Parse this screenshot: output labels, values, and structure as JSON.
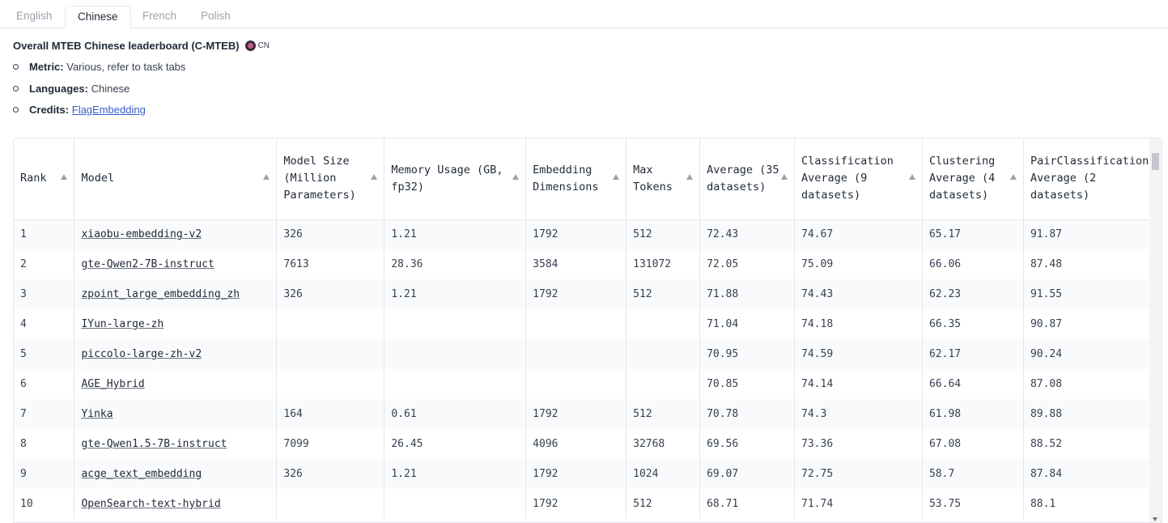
{
  "tabs": [
    "English",
    "Chinese",
    "French",
    "Polish"
  ],
  "active_tab": "Chinese",
  "description": {
    "title": "Overall MTEB Chinese leaderboard (C-MTEB)",
    "flag_code": "CN",
    "metric_label": "Metric:",
    "metric_value": "Various, refer to task tabs",
    "languages_label": "Languages:",
    "languages_value": "Chinese",
    "credits_label": "Credits:",
    "credits_link": "FlagEmbedding"
  },
  "table": {
    "headers": [
      "Rank",
      "Model",
      "Model Size (Million Parameters)",
      "Memory Usage (GB, fp32)",
      "Embedding Dimensions",
      "Max Tokens",
      "Average (35 datasets)",
      "Classification Average (9 datasets)",
      "Clustering Average (4 datasets)",
      "PairClassification Average (2 datasets)"
    ],
    "rows": [
      [
        "1",
        "xiaobu-embedding-v2",
        "326",
        "1.21",
        "1792",
        "512",
        "72.43",
        "74.67",
        "65.17",
        "91.87"
      ],
      [
        "2",
        "gte-Qwen2-7B-instruct",
        "7613",
        "28.36",
        "3584",
        "131072",
        "72.05",
        "75.09",
        "66.06",
        "87.48"
      ],
      [
        "3",
        "zpoint_large_embedding_zh",
        "326",
        "1.21",
        "1792",
        "512",
        "71.88",
        "74.43",
        "62.23",
        "91.55"
      ],
      [
        "4",
        "IYun-large-zh",
        "",
        "",
        "",
        "",
        "71.04",
        "74.18",
        "66.35",
        "90.87"
      ],
      [
        "5",
        "piccolo-large-zh-v2",
        "",
        "",
        "",
        "",
        "70.95",
        "74.59",
        "62.17",
        "90.24"
      ],
      [
        "6",
        "AGE_Hybrid",
        "",
        "",
        "",
        "",
        "70.85",
        "74.14",
        "66.64",
        "87.08"
      ],
      [
        "7",
        "Yinka",
        "164",
        "0.61",
        "1792",
        "512",
        "70.78",
        "74.3",
        "61.98",
        "89.88"
      ],
      [
        "8",
        "gte-Qwen1.5-7B-instruct",
        "7099",
        "26.45",
        "4096",
        "32768",
        "69.56",
        "73.36",
        "67.08",
        "88.52"
      ],
      [
        "9",
        "acge_text_embedding",
        "326",
        "1.21",
        "1792",
        "1024",
        "69.07",
        "72.75",
        "58.7",
        "87.84"
      ],
      [
        "10",
        "OpenSearch-text-hybrid",
        "",
        "",
        "1792",
        "512",
        "68.71",
        "71.74",
        "53.75",
        "88.1"
      ]
    ]
  }
}
